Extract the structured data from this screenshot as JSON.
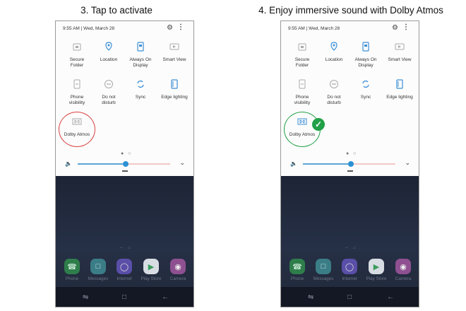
{
  "captions": {
    "left": "3. Tap to activate",
    "right": "4. Enjoy immersive sound with Dolby Atmos"
  },
  "status_bar": {
    "time": "9:55 AM",
    "date": "Wed, March 28",
    "settings_icon": "gear-icon",
    "more_icon": "more-vert-icon"
  },
  "quick_tiles": [
    {
      "label1": "Secure",
      "label2": "Folder",
      "icon": "secure-folder-icon"
    },
    {
      "label1": "Location",
      "label2": "",
      "icon": "location-icon"
    },
    {
      "label1": "Always On",
      "label2": "Display",
      "icon": "always-on-display-icon"
    },
    {
      "label1": "Smart View",
      "label2": "",
      "icon": "smart-view-icon"
    },
    {
      "label1": "Phone",
      "label2": "visibility",
      "icon": "phone-visibility-icon"
    },
    {
      "label1": "Do not",
      "label2": "disturb",
      "icon": "do-not-disturb-icon"
    },
    {
      "label1": "Sync",
      "label2": "",
      "icon": "sync-icon"
    },
    {
      "label1": "Edge lighting",
      "label2": "",
      "icon": "edge-lighting-icon"
    },
    {
      "label1": "Dolby Atmos",
      "label2": "",
      "icon": "dolby-atmos-icon"
    }
  ],
  "page_dots": "● ○",
  "volume_level": 0.52,
  "highlight_colors": {
    "left": "#d94141",
    "right": "#21a047"
  },
  "apps": [
    {
      "name": "Phone",
      "icon": "phone-icon",
      "color": "#2e7d4b"
    },
    {
      "name": "Messages",
      "icon": "messages-icon",
      "color": "#3b7d86"
    },
    {
      "name": "Internet",
      "icon": "internet-icon",
      "color": "#5a4fa8"
    },
    {
      "name": "Play Store",
      "icon": "play-store-icon",
      "color": "#d8dde3"
    },
    {
      "name": "Camera",
      "icon": "camera-icon",
      "color": "#8e5090"
    }
  ],
  "nav_icons": [
    "recents-icon",
    "home-icon",
    "back-icon"
  ]
}
